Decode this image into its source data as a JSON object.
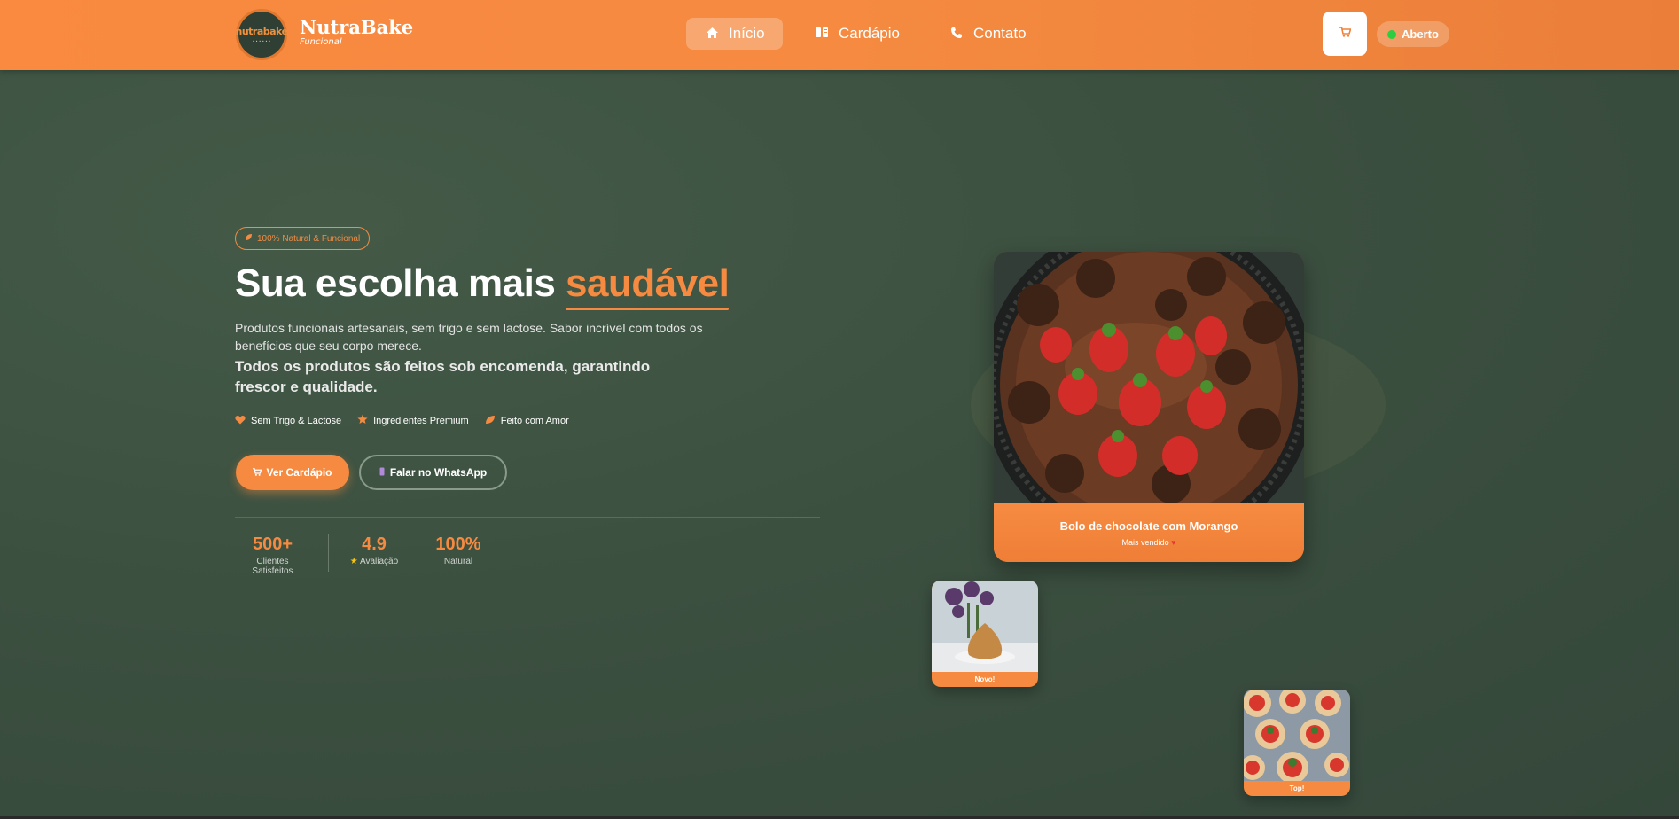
{
  "header": {
    "brand_name": "NutraBake",
    "brand_sub": "Funcional",
    "logo_text": "nutrabake",
    "nav": [
      {
        "label": "Início",
        "icon": "home-icon",
        "active": true
      },
      {
        "label": "Cardápio",
        "icon": "menu-book-icon",
        "active": false
      },
      {
        "label": "Contato",
        "icon": "phone-icon",
        "active": false
      }
    ],
    "cart_icon": "cart-icon",
    "status": "Aberto",
    "status_color": "#2ecc40"
  },
  "hero": {
    "badge": "100% Natural & Funcional",
    "headline_prefix": "Sua escolha mais",
    "headline_accent": "saudável",
    "description": "Produtos funcionais artesanais, sem trigo e sem lactose. Sabor incrível com todos os benefícios que seu corpo merece.",
    "description_bold": "Todos os produtos são feitos sob encomenda, garantindo frescor e qualidade.",
    "features": [
      {
        "label": "Sem Trigo & Lactose",
        "icon": "heart-icon"
      },
      {
        "label": "Ingredientes Premium",
        "icon": "star-icon"
      },
      {
        "label": "Feito com Amor",
        "icon": "leaf-icon"
      }
    ],
    "primary_button": "Ver Cardápio",
    "secondary_button": "Falar no WhatsApp",
    "stats": [
      {
        "value": "500+",
        "label": "Clientes Satisfeitos"
      },
      {
        "value": "4.9",
        "label": "Avaliação"
      },
      {
        "value": "100%",
        "label": "Natural"
      }
    ]
  },
  "products": {
    "featured": {
      "title": "Bolo de chocolate com Morango",
      "subtitle": "Mais vendido"
    },
    "small_1": {
      "label": "Novo!"
    },
    "small_2": {
      "label": "Top!"
    }
  },
  "colors": {
    "accent": "#f58a40",
    "background": "#3d5240"
  }
}
